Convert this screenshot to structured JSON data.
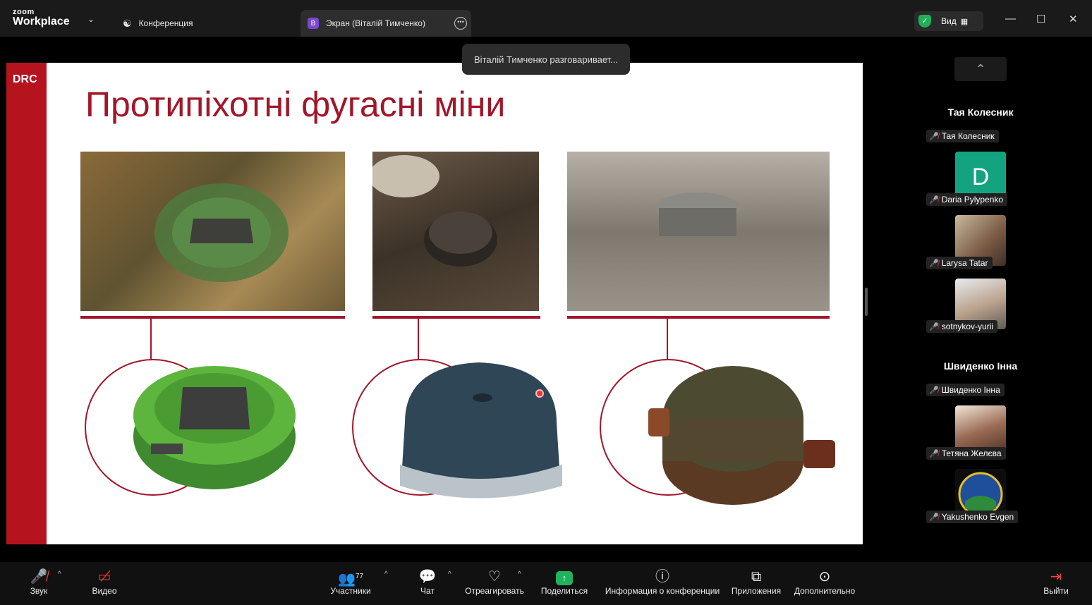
{
  "app": {
    "brand_top": "zoom",
    "brand_bottom": "Workplace"
  },
  "tabs": [
    {
      "label": "Конференция"
    },
    {
      "label": "Экран (Віталій Тимченко)",
      "badge": "B"
    }
  ],
  "view_button": {
    "label": "Вид"
  },
  "tooltip": "Віталій Тимченко разговаривает...",
  "slide": {
    "logo": "DRC",
    "title": "Протипіхотні фугасні міни"
  },
  "panel": {
    "sections": [
      {
        "name": "Тая Колесник",
        "participants": [
          {
            "name": "Тая Колесник",
            "avatar": null
          },
          {
            "name": "Daria Pylypenko",
            "avatar": "D",
            "color": "#14a37f"
          },
          {
            "name": "Larysa Tatar",
            "avatar": "photo"
          },
          {
            "name": "sotnykov-yurii",
            "avatar": "photo"
          }
        ]
      },
      {
        "name": "Швиденко Інна",
        "participants": [
          {
            "name": "Швиденко Інна",
            "avatar": null
          },
          {
            "name": "Тетяна Желєва",
            "avatar": "photo"
          },
          {
            "name": "Yakushenko Evgen",
            "avatar": "logo"
          }
        ]
      }
    ]
  },
  "toolbar": {
    "audio": "Звук",
    "video": "Видео",
    "participants": "Участники",
    "participants_count": "77",
    "chat": "Чат",
    "react": "Отреагировать",
    "share": "Поделиться",
    "info": "Информация о конференции",
    "apps": "Приложения",
    "more": "Дополнительно",
    "leave": "Выйти"
  },
  "colors": {
    "slide_accent": "#a3162a",
    "drc_red": "#b5141f",
    "share_green": "#1fb35e"
  }
}
